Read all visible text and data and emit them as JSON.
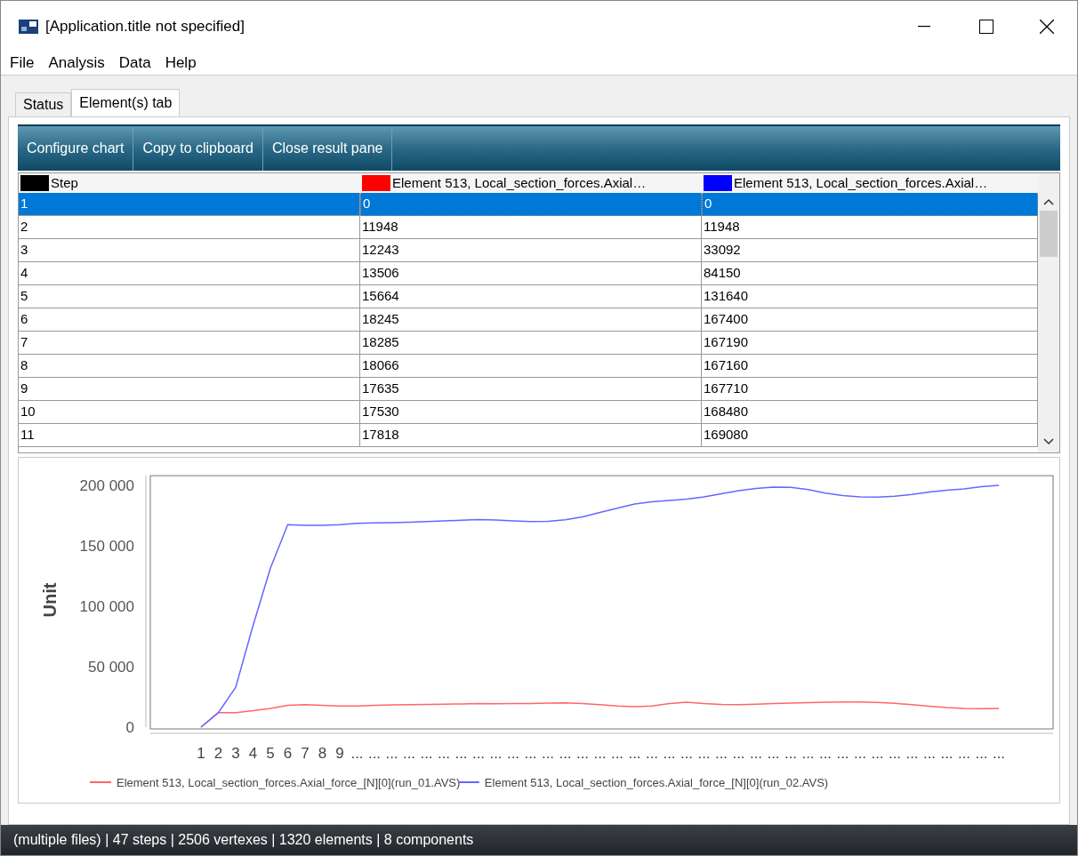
{
  "window": {
    "title": "[Application.title not specified]"
  },
  "menu": [
    "File",
    "Analysis",
    "Data",
    "Help"
  ],
  "tabs": [
    {
      "label": "Status",
      "selected": false
    },
    {
      "label": "Element(s) tab",
      "selected": true
    }
  ],
  "toolbar": [
    "Configure chart",
    "Copy to clipboard",
    "Close result pane"
  ],
  "table": {
    "columns": [
      {
        "label": "Step",
        "color": "#000000"
      },
      {
        "label": "Element 513, Local_section_forces.Axial…",
        "color": "#ff0000"
      },
      {
        "label": "Element 513, Local_section_forces.Axial…",
        "color": "#0000ff"
      }
    ],
    "rows": [
      {
        "cells": [
          "1",
          "0",
          "0"
        ],
        "selected": true
      },
      {
        "cells": [
          "2",
          "11948",
          "11948"
        ],
        "selected": false
      },
      {
        "cells": [
          "3",
          "12243",
          "33092"
        ],
        "selected": false
      },
      {
        "cells": [
          "4",
          "13506",
          "84150"
        ],
        "selected": false
      },
      {
        "cells": [
          "5",
          "15664",
          "131640"
        ],
        "selected": false
      },
      {
        "cells": [
          "6",
          "18245",
          "167400"
        ],
        "selected": false
      },
      {
        "cells": [
          "7",
          "18285",
          "167190"
        ],
        "selected": false
      },
      {
        "cells": [
          "8",
          "18066",
          "167160"
        ],
        "selected": false
      },
      {
        "cells": [
          "9",
          "17635",
          "167710"
        ],
        "selected": false
      },
      {
        "cells": [
          "10",
          "17530",
          "168480"
        ],
        "selected": false
      },
      {
        "cells": [
          "11",
          "17818",
          "169080"
        ],
        "selected": false
      }
    ]
  },
  "chart": {
    "chart_data": {
      "type": "line",
      "ylabel": "Unit",
      "categories": [
        "1",
        "2",
        "3",
        "4",
        "5",
        "6",
        "7",
        "8",
        "9",
        "...",
        "...",
        "...",
        "...",
        "...",
        "...",
        "...",
        "...",
        "...",
        "...",
        "...",
        "...",
        "...",
        "...",
        "...",
        "...",
        "...",
        "...",
        "...",
        "...",
        "...",
        "...",
        "...",
        "...",
        "...",
        "...",
        "...",
        "...",
        "...",
        "...",
        "...",
        "...",
        "...",
        "...",
        "...",
        "...",
        "...",
        "..."
      ],
      "ylim": [
        0,
        208000
      ],
      "legend": true,
      "yticks": [
        {
          "value": 0,
          "label": "0"
        },
        {
          "value": 50000,
          "label": "50 000"
        },
        {
          "value": 100000,
          "label": "100 000"
        },
        {
          "value": 150000,
          "label": "150 000"
        },
        {
          "value": 200000,
          "label": "200 000"
        }
      ],
      "series": [
        {
          "name": "Element 513, Local_section_forces.Axial_force_[N][0](run_01.AVS)",
          "color": "#ff6666",
          "values": [
            0,
            12000,
            12000,
            13500,
            15500,
            18000,
            18500,
            18000,
            17500,
            17500,
            18000,
            18300,
            18500,
            18700,
            19000,
            19200,
            19400,
            19300,
            19400,
            19500,
            19800,
            20000,
            19500,
            18500,
            17500,
            17000,
            17500,
            19500,
            20500,
            19500,
            18800,
            18600,
            19000,
            19500,
            19800,
            20200,
            20600,
            20800,
            20700,
            20400,
            19600,
            18500,
            17200,
            16200,
            15500,
            15200,
            15400
          ]
        },
        {
          "name": "Element 513, Local_section_forces.Axial_force_[N][0](run_02.AVS)",
          "color": "#6666ff",
          "values": [
            0,
            12000,
            33000,
            84000,
            131500,
            167500,
            167000,
            167000,
            167500,
            168500,
            169000,
            169200,
            169500,
            170000,
            170600,
            171200,
            171600,
            171300,
            170600,
            170000,
            170300,
            171500,
            174000,
            177500,
            181000,
            184500,
            186500,
            187500,
            188500,
            190500,
            193000,
            195500,
            197500,
            198500,
            198300,
            196500,
            193500,
            191500,
            190500,
            190200,
            191000,
            192500,
            194500,
            196000,
            197000,
            199000,
            200000
          ]
        }
      ]
    }
  },
  "status_bar": "(multiple files) | 47 steps | 2506 vertexes | 1320 elements | 8 components"
}
